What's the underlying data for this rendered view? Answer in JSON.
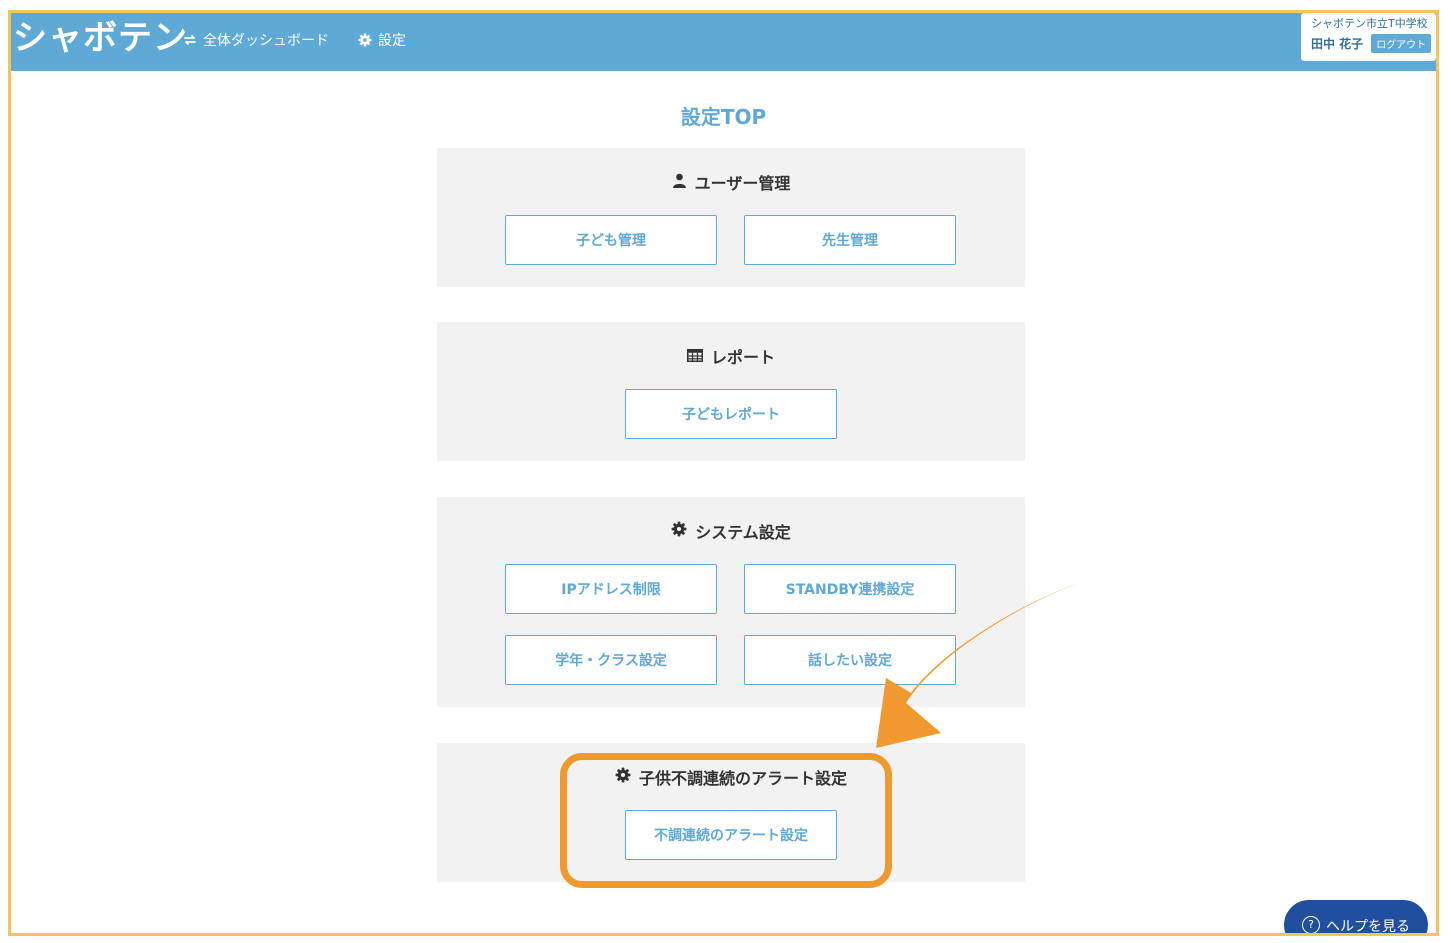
{
  "header": {
    "logo": "シャボテン",
    "nav": {
      "dashboard": "全体ダッシュボード",
      "settings": "設定"
    },
    "user": {
      "school": "シャボテン市立T中学校",
      "name": "田中 花子",
      "logout": "ログアウト"
    }
  },
  "page_title": "設定TOP",
  "sections": {
    "user_management": {
      "title": "ユーザー管理",
      "buttons": [
        "子ども管理",
        "先生管理"
      ]
    },
    "report": {
      "title": "レポート",
      "buttons": [
        "子どもレポート"
      ]
    },
    "system": {
      "title": "システム設定",
      "buttons": [
        "IPアドレス制限",
        "STANDBY連携設定",
        "学年・クラス設定",
        "話したい設定"
      ]
    },
    "alert": {
      "title": "子供不調連続のアラート設定",
      "buttons": [
        "不調連続のアラート設定"
      ]
    }
  },
  "help": {
    "label": "ヘルプを見る"
  },
  "colors": {
    "header": "#5ea9d6",
    "accent": "#5ea9d6",
    "panel": "#f2f2f2",
    "annotation": "#f0992e",
    "help": "#1f4f9e"
  }
}
